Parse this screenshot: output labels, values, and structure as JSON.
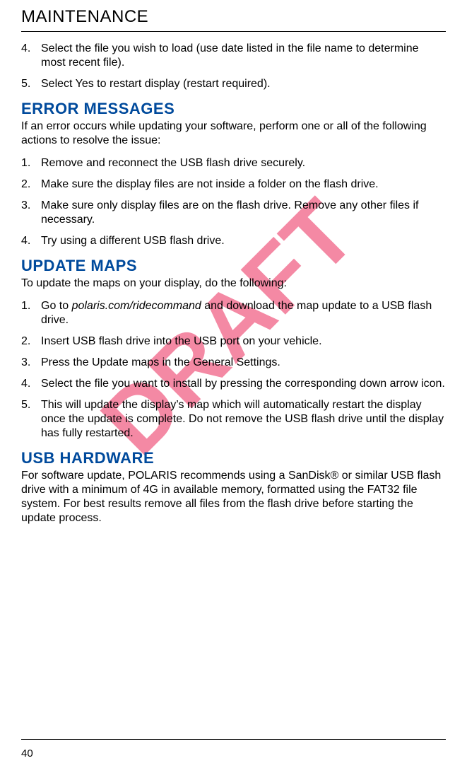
{
  "header": "MAINTENANCE",
  "list1": {
    "items": [
      {
        "n": "4.",
        "t": "Select the file you wish to load (use date listed in the file name to determine most recent file)."
      },
      {
        "n": "5.",
        "t": "Select Yes to restart display (restart required)."
      }
    ]
  },
  "error": {
    "title": "ERROR MESSAGES",
    "intro": "If an error occurs while updating your software, perform one or all of the following actions to resolve the issue:",
    "items": [
      {
        "n": "1.",
        "t": "Remove and reconnect the USB flash drive securely."
      },
      {
        "n": "2.",
        "t": "Make sure the display files are not inside a folder on the flash drive."
      },
      {
        "n": "3.",
        "t": "Make sure only display files are on the flash drive. Remove any other files if necessary."
      },
      {
        "n": "4.",
        "t": "Try using a different USB flash drive."
      }
    ]
  },
  "maps": {
    "title": "UPDATE MAPS",
    "intro": "To update the maps on your display, do the following:",
    "items": [
      {
        "n": "1.",
        "pre": "Go to ",
        "em": "polaris.com/ridecommand",
        "post": " and download the map update to a USB flash drive."
      },
      {
        "n": "2.",
        "t": "Insert USB flash drive into the USB port on your vehicle."
      },
      {
        "n": "3.",
        "t": "Press the Update maps in the General Settings."
      },
      {
        "n": "4.",
        "t": "Select the file you want to install by pressing the corresponding down arrow icon."
      },
      {
        "n": "5.",
        "t": "This will update the display’s map which will automatically restart the display once the update is complete. Do not remove the USB flash drive until the display has fully restarted."
      }
    ]
  },
  "usb": {
    "title": "USB HARDWARE",
    "intro": "For software update, POLARIS recommends using a SanDisk® or similar USB flash drive with a minimum of 4G in available memory, formatted using the FAT32 file system. For best results remove all files from the flash drive before starting the update process."
  },
  "page_number": "40",
  "watermark_text": "DRAFT"
}
